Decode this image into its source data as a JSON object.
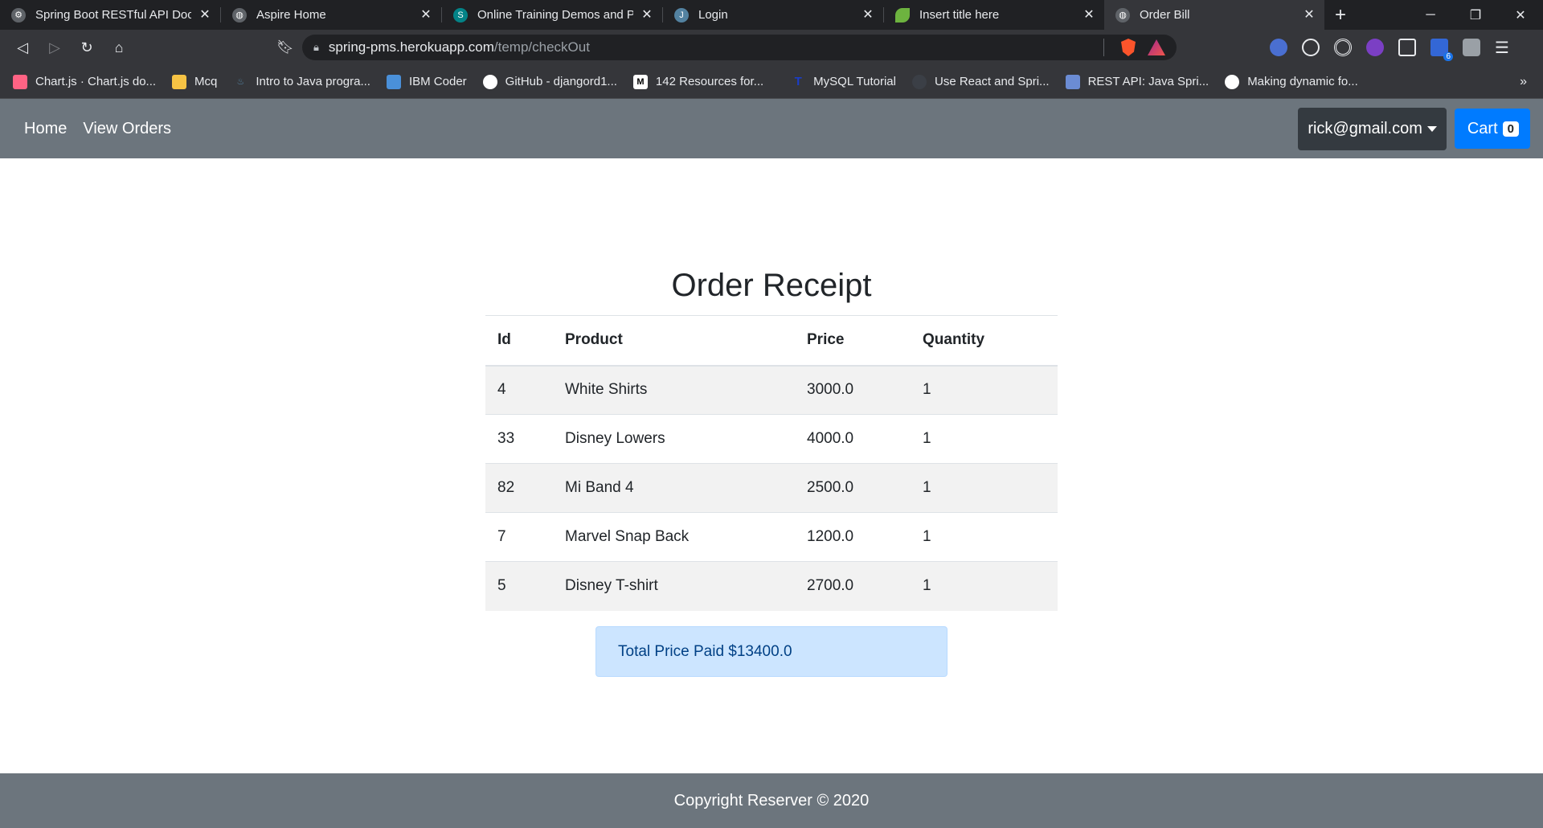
{
  "browser": {
    "tabs": [
      {
        "title": "Spring Boot RESTful API Documentation",
        "icon": "swagger-icon",
        "color": "#5f6368"
      },
      {
        "title": "Aspire Home",
        "icon": "globe-icon",
        "color": "#5f6368"
      },
      {
        "title": "Online Training Demos and PP",
        "icon": "sharepoint-icon",
        "color": "#038387"
      },
      {
        "title": "Login",
        "icon": "java-icon",
        "color": "#5382a1"
      },
      {
        "title": "Insert title here",
        "icon": "spring-leaf-icon",
        "color": "#6db33f"
      },
      {
        "title": "Order Bill",
        "icon": "globe-icon",
        "color": "#5f6368"
      }
    ],
    "close_glyph": "✕",
    "new_tab_glyph": "+",
    "url_host": "spring-pms.herokuapp.com",
    "url_path": "/temp/checkOut",
    "extension_badge": "6",
    "bookmarks": [
      {
        "label": "Chart.js · Chart.js do...",
        "icon": "chartjs-icon",
        "color": "#ff6384"
      },
      {
        "label": "Mcq",
        "icon": "folder-icon",
        "color": "#f6c344"
      },
      {
        "label": "Intro to Java progra...",
        "icon": "java-icon",
        "color": "#5382a1"
      },
      {
        "label": "IBM Coder",
        "icon": "ibm-icon",
        "color": "#4a90d9"
      },
      {
        "label": "GitHub - djangord1...",
        "icon": "github-icon",
        "color": "#ffffff"
      },
      {
        "label": "142 Resources for...",
        "icon": "medium-icon",
        "color": "#ffffff"
      },
      {
        "label": "MySQL Tutorial",
        "icon": "mysql-icon",
        "color": "#1a3dc7"
      },
      {
        "label": "Use React and Spri...",
        "icon": "okta-icon",
        "color": "#3b3f46"
      },
      {
        "label": "REST API: Java Spri...",
        "icon": "devto-icon",
        "color": "#6b8cd4"
      },
      {
        "label": "Making dynamic fo...",
        "icon": "globe-icon",
        "color": "#ffffff"
      }
    ],
    "bookmarks_more": "»"
  },
  "nav": {
    "links": [
      "Home",
      "View Orders"
    ],
    "user": "rick@gmail.com",
    "cart_label": "Cart",
    "cart_count": "0"
  },
  "receipt": {
    "title": "Order Receipt",
    "columns": [
      "Id",
      "Product",
      "Price",
      "Quantity"
    ],
    "rows": [
      [
        "4",
        "White Shirts",
        "3000.0",
        "1"
      ],
      [
        "33",
        "Disney Lowers",
        "4000.0",
        "1"
      ],
      [
        "82",
        "Mi Band 4",
        "2500.0",
        "1"
      ],
      [
        "7",
        "Marvel Snap Back",
        "1200.0",
        "1"
      ],
      [
        "5",
        "Disney T-shirt",
        "2700.0",
        "1"
      ]
    ],
    "total": "Total Price Paid $13400.0"
  },
  "footer": {
    "text": "Copyright Reserver © 2020"
  }
}
